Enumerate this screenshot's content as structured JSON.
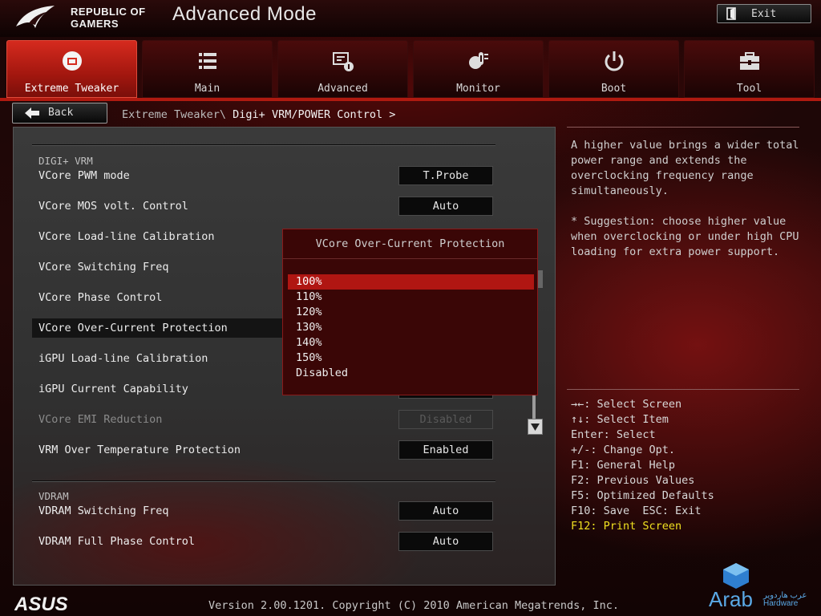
{
  "brand": {
    "line1": "REPUBLIC OF",
    "line2": "GAMERS"
  },
  "header": {
    "title": "Advanced Mode",
    "exit_label": "Exit"
  },
  "tabs": [
    {
      "label": "Extreme Tweaker",
      "icon": "tweaker-icon",
      "active": true
    },
    {
      "label": "Main",
      "icon": "list-icon"
    },
    {
      "label": "Advanced",
      "icon": "advanced-icon"
    },
    {
      "label": "Monitor",
      "icon": "thermometer-icon"
    },
    {
      "label": "Boot",
      "icon": "power-icon"
    },
    {
      "label": "Tool",
      "icon": "toolbox-icon"
    }
  ],
  "breadcrumb": {
    "back_label": "Back",
    "path_prefix": "Extreme Tweaker\\ ",
    "path_current": "Digi+ VRM/POWER Control >"
  },
  "sections": {
    "digi": "DIGI+ VRM",
    "vdram": "VDRAM"
  },
  "settings": [
    {
      "label": "VCore PWM mode",
      "value": "T.Probe"
    },
    {
      "label": "VCore MOS volt. Control",
      "value": "Auto"
    },
    {
      "label": "VCore Load-line Calibration",
      "value": ""
    },
    {
      "label": "VCore Switching Freq",
      "value": ""
    },
    {
      "label": "VCore Phase Control",
      "value": ""
    },
    {
      "label": "VCore Over-Current Protection",
      "value": ""
    },
    {
      "label": "iGPU Load-line Calibration",
      "value": ""
    },
    {
      "label": "iGPU Current Capability",
      "value": ""
    },
    {
      "label": "VCore EMI Reduction",
      "value": "Disabled",
      "disabled": true
    },
    {
      "label": "VRM Over Temperature Protection",
      "value": "Enabled"
    },
    {
      "label": "VDRAM Switching Freq",
      "value": "Auto"
    },
    {
      "label": "VDRAM Full Phase Control",
      "value": "Auto"
    }
  ],
  "popup": {
    "title": "VCore Over-Current Protection",
    "options": [
      "100%",
      "110%",
      "120%",
      "130%",
      "140%",
      "150%",
      "Disabled"
    ],
    "selected": "100%"
  },
  "help": {
    "description": "A higher value brings a wider total power range and extends the overclocking frequency range simultaneously.",
    "suggestion": "* Suggestion: choose higher value when overclocking or under high CPU loading for extra power support."
  },
  "keys": [
    "→←: Select Screen",
    "↑↓: Select Item",
    "Enter: Select",
    "+/-: Change Opt.",
    "F1: General Help",
    "F2: Previous Values",
    "F5: Optimized Defaults",
    "F10: Save  ESC: Exit",
    "F12: Print Screen"
  ],
  "footer": {
    "brand": "ASUS",
    "version": "Version 2.00.1201. Copyright (C) 2010 American Megatrends, Inc."
  },
  "watermark": {
    "text": "Arab",
    "sub1": "عرب هاردوير",
    "sub2": "Hardware"
  },
  "colors": {
    "accent": "#b01612",
    "hotkey": "#f0e020",
    "tab_active": "#c8231a"
  }
}
